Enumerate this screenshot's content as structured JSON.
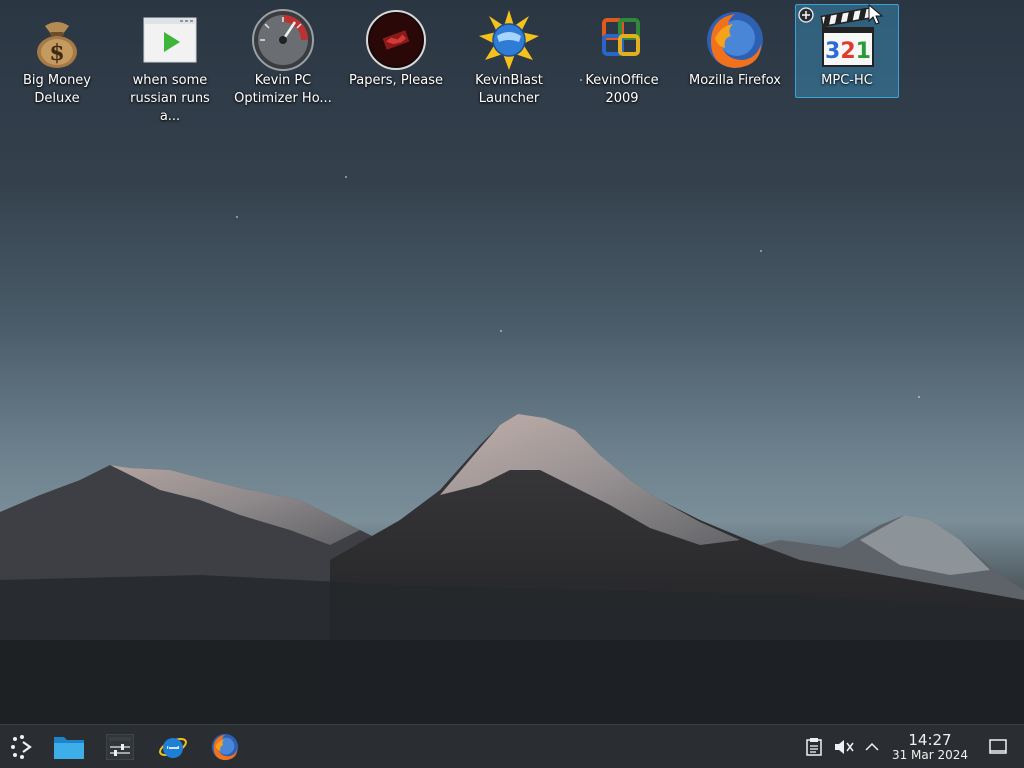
{
  "desktop": {
    "icons": [
      {
        "label": "Big Money Deluxe",
        "icon": "money-bag-icon"
      },
      {
        "label": "when some russian runs a...",
        "icon": "video-file-icon"
      },
      {
        "label": "Kevin PC Optimizer Ho...",
        "icon": "speedometer-icon"
      },
      {
        "label": "Papers, Please",
        "icon": "papers-please-icon"
      },
      {
        "label": "KevinBlast Launcher",
        "icon": "globe-sun-icon"
      },
      {
        "label": "KevinOffice 2009",
        "icon": "office-icon"
      },
      {
        "label": "Mozilla Firefox",
        "icon": "firefox-icon"
      },
      {
        "label": "MPC-HC",
        "icon": "clapperboard-icon",
        "selected": true
      }
    ],
    "mpc_digits": "321"
  },
  "taskbar": {
    "launchers": [
      {
        "name": "application-launcher",
        "icon": "kde-launcher-icon"
      },
      {
        "name": "file-manager",
        "icon": "folder-icon"
      },
      {
        "name": "system-settings",
        "icon": "settings-sliders-icon"
      },
      {
        "name": "internet-explorer",
        "icon": "internet-explorer-icon"
      },
      {
        "name": "firefox",
        "icon": "firefox-icon"
      }
    ],
    "tray": [
      {
        "name": "clipboard",
        "icon": "clipboard-icon"
      },
      {
        "name": "volume",
        "icon": "speaker-muted-icon"
      },
      {
        "name": "expand-tray",
        "icon": "chevron-up-icon"
      }
    ],
    "clock": {
      "time": "14:27",
      "date": "31 Mar 2024"
    },
    "show_desktop_icon": "show-desktop-icon"
  },
  "colors": {
    "selection": "#3daee9",
    "taskbar": "#2a2e32",
    "text": "#eff0f1"
  }
}
